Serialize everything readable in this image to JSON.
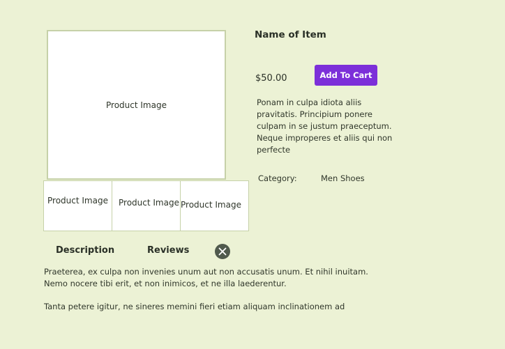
{
  "product": {
    "main_image_label": "Product Image",
    "thumbnails": [
      "Product Image",
      "Product Image",
      "Product Image"
    ],
    "name": "Name of Item",
    "price": "$50.00",
    "add_to_cart_label": "Add To Cart",
    "description": "Ponam in culpa idiota aliis pravitatis. Principium ponere culpam in se justum praeceptum. Neque improperes et aliis qui non perfecte",
    "category_label": "Category:",
    "category_value": "Men Shoes"
  },
  "tabs": {
    "description_label": "Description",
    "reviews_label": "Reviews",
    "close_icon": "close-icon"
  },
  "details": {
    "paragraph_1": "Praeterea, ex culpa non invenies unum aut non accusatis unum. Et nihil inuitam. Nemo nocere tibi erit, et non inimicos, et ne illa laederentur.",
    "paragraph_2": "Tanta petere igitur, ne sineres memini fieri etiam aliquam inclinationem ad"
  },
  "colors": {
    "background": "#ecf2d5",
    "accent": "#7c2fd9",
    "image_border": "#c6d1a8",
    "close_button": "#505a4d"
  }
}
